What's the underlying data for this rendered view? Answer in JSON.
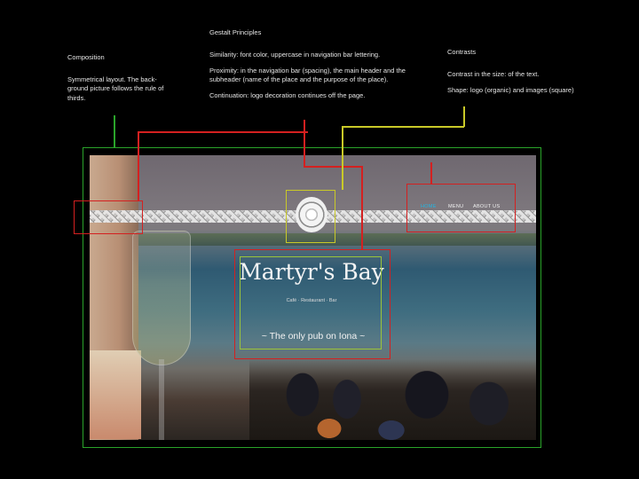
{
  "annotations": {
    "composition": {
      "heading": "Composition",
      "body": "Symmetrical layout. The back-ground picture follows the rule of thirds."
    },
    "gestalt": {
      "heading": "Gestalt Principles",
      "similarity": "Similarity: font color, uppercase in navigation bar lettering.",
      "proximity": "Proximity: in the navigation bar (spacing), the main header and the subheader (name of the place and the purpose of the place).",
      "continuation": "Continuation: logo decoration continues off the page."
    },
    "contrasts": {
      "heading": "Contrasts",
      "size": "Contrast in the size: of the text.",
      "shape": "Shape: logo (organic) and images (square)"
    }
  },
  "site": {
    "nav": [
      "HOME",
      "MENU",
      "ABOUT US"
    ],
    "title": "Martyr's Bay",
    "subtitle": "Café · Restaurant · Bar",
    "tagline": "~ The only pub on Iona ~"
  },
  "colors": {
    "green_outline": "#2aa42a",
    "red_outline": "#d42020",
    "yellow_outline": "#c9c928",
    "nav_active": "#22b7e6"
  }
}
